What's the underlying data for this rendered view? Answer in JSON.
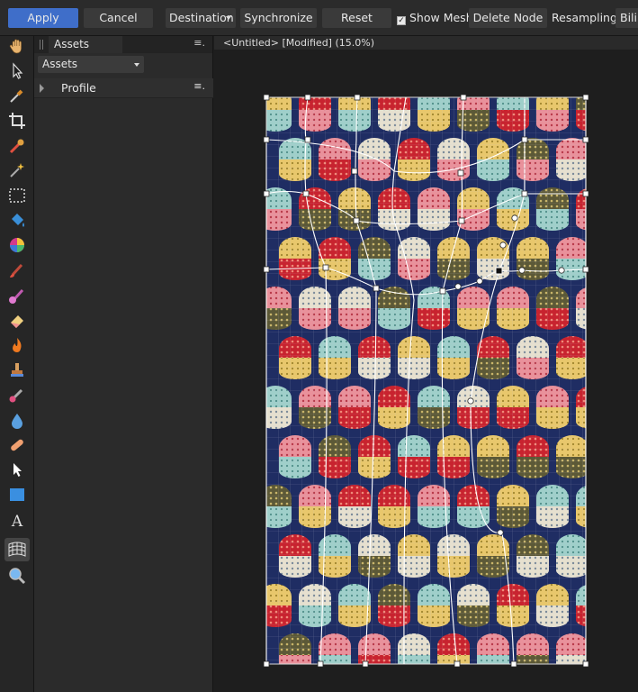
{
  "toolbar": {
    "apply_label": "Apply",
    "cancel_label": "Cancel",
    "destination_label": "Destination",
    "synchronize_label": "Synchronize",
    "reset_label": "Reset",
    "show_mesh_label": "Show Mesh",
    "show_mesh_checked": true,
    "delete_node_label": "Delete Node",
    "resampling_label": "Resampling:",
    "resampling_value": "Bilin"
  },
  "tools": [
    "hand-tool-icon",
    "move-tool-icon",
    "eyedropper-icon",
    "crop-icon",
    "selection-brush-icon",
    "magic-wand-icon",
    "marquee-icon",
    "flood-fill-icon",
    "color-wheel-icon",
    "paint-brush-icon",
    "mixer-brush-icon",
    "eraser-icon",
    "burn-icon",
    "clone-stamp-icon",
    "retouch-brush-icon",
    "blur-drop-icon",
    "healing-bandage-icon",
    "node-pointer-icon",
    "rectangle-shape-icon",
    "text-icon",
    "mesh-warp-icon",
    "zoom-icon"
  ],
  "panel": {
    "tab_label": "Assets",
    "dropdown_value": "Assets",
    "category_label": "Profile",
    "menu_glyph": "≡."
  },
  "document": {
    "title": "<Untitled> [Modified] (15.0%)"
  },
  "colors": {
    "accent": "#3f6ec9",
    "fabric_navy": "#1f2d63",
    "red": "#c8232f",
    "pink": "#e9919b",
    "yellow": "#e8c76c",
    "teal": "#9fcfca",
    "olive": "#5c5937",
    "cream": "#e6e0cf"
  }
}
